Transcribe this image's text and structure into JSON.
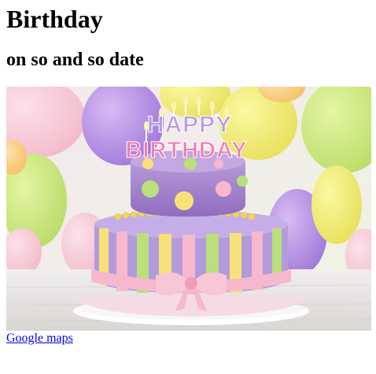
{
  "page": {
    "title": "Birthday",
    "subtitle": "on so and so date",
    "link_text": "Google maps"
  },
  "image": {
    "alt": "birthday-cake-photo",
    "cake_topper_line1": "HAPPY",
    "cake_topper_line2": "BIRTHDAY"
  },
  "colors": {
    "link": "#0000ee",
    "text": "#000000",
    "background": "#ffffff"
  }
}
